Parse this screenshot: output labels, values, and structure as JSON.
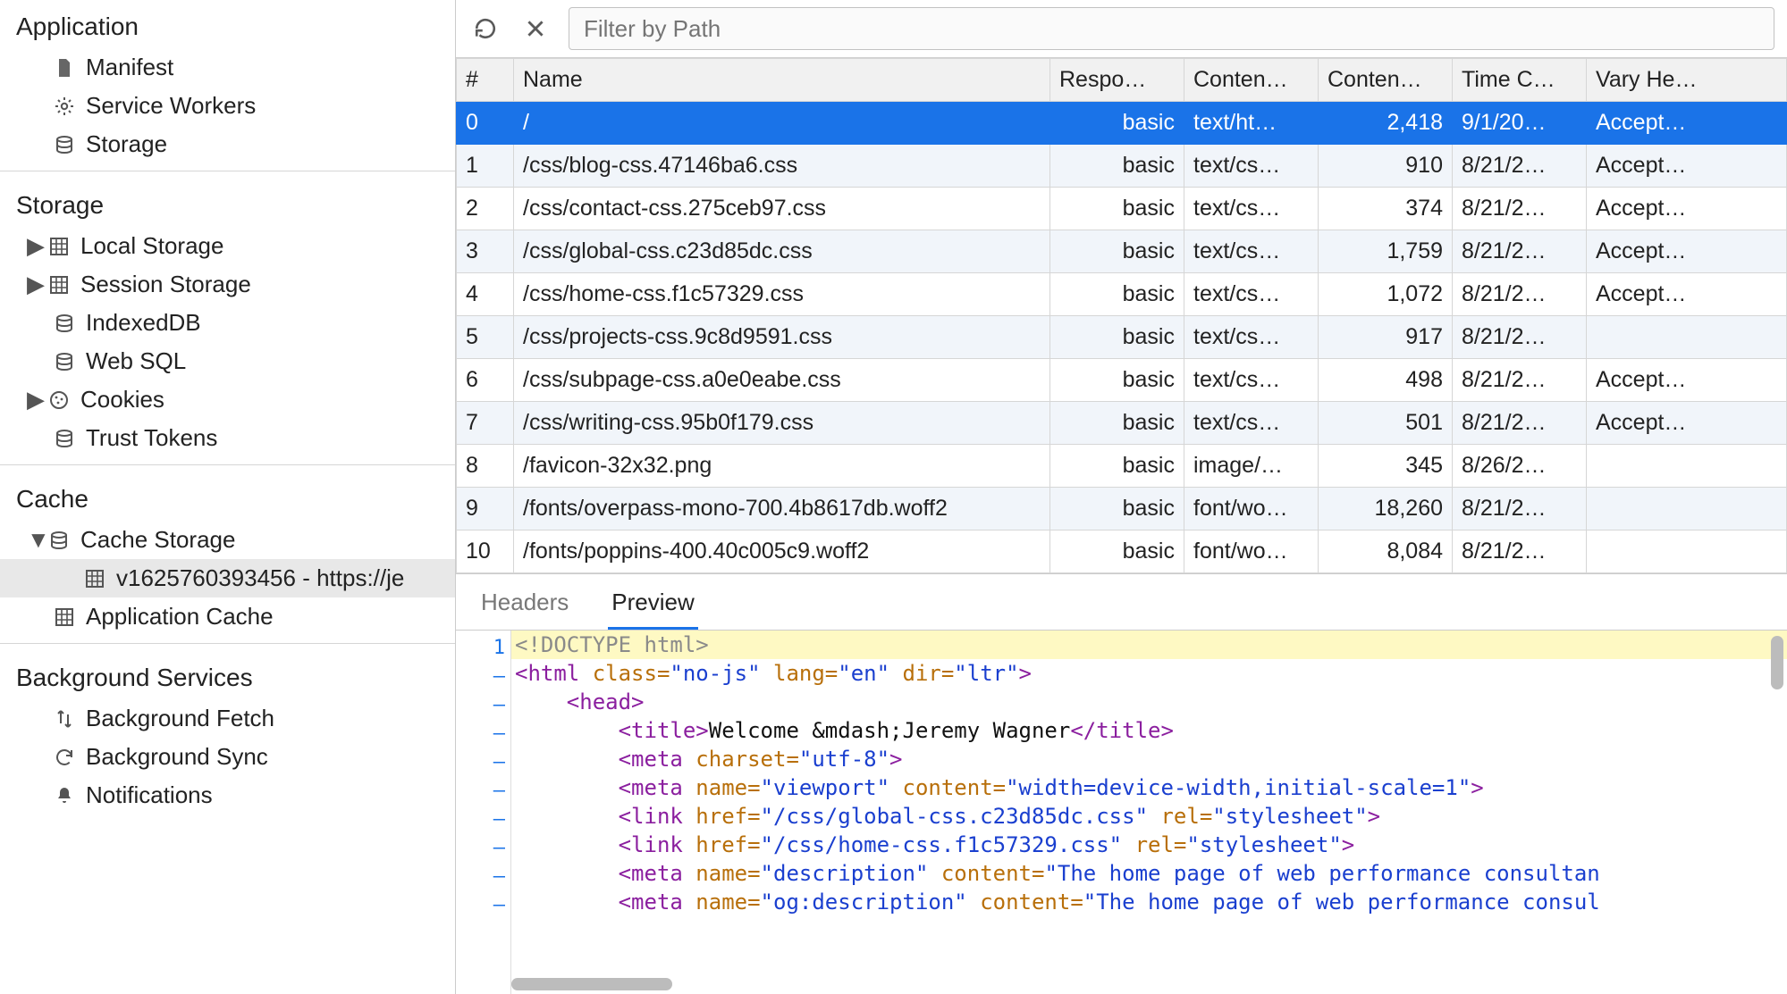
{
  "sidebar": {
    "sections": [
      {
        "title": "Application",
        "items": [
          {
            "label": "Manifest",
            "icon": "file-icon"
          },
          {
            "label": "Service Workers",
            "icon": "gear-icon"
          },
          {
            "label": "Storage",
            "icon": "disks-icon"
          }
        ]
      },
      {
        "title": "Storage",
        "items": [
          {
            "label": "Local Storage",
            "icon": "grid-icon",
            "expandable": true
          },
          {
            "label": "Session Storage",
            "icon": "grid-icon",
            "expandable": true
          },
          {
            "label": "IndexedDB",
            "icon": "disks-icon"
          },
          {
            "label": "Web SQL",
            "icon": "disks-icon"
          },
          {
            "label": "Cookies",
            "icon": "cookie-icon",
            "expandable": true
          },
          {
            "label": "Trust Tokens",
            "icon": "disks-icon"
          }
        ]
      },
      {
        "title": "Cache",
        "items": [
          {
            "label": "Cache Storage",
            "icon": "disks-icon",
            "expandable": true,
            "expanded": true,
            "children": [
              {
                "label": "v1625760393456 - https://je",
                "icon": "grid-icon",
                "selected": true
              }
            ]
          },
          {
            "label": "Application Cache",
            "icon": "grid-icon"
          }
        ]
      },
      {
        "title": "Background Services",
        "items": [
          {
            "label": "Background Fetch",
            "icon": "arrows-updown-icon"
          },
          {
            "label": "Background Sync",
            "icon": "sync-icon"
          },
          {
            "label": "Notifications",
            "icon": "bell-icon"
          }
        ]
      }
    ]
  },
  "toolbar": {
    "refresh_tooltip": "Refresh",
    "clear_tooltip": "Clear",
    "filter_placeholder": "Filter by Path"
  },
  "table": {
    "columns": [
      "#",
      "Name",
      "Respo…",
      "Conten…",
      "Conten…",
      "Time C…",
      "Vary He…"
    ],
    "rows": [
      {
        "idx": "0",
        "name": "/",
        "resp": "basic",
        "ctype": "text/ht…",
        "clen": "2,418",
        "time": "9/1/20…",
        "vary": "Accept…",
        "selected": true
      },
      {
        "idx": "1",
        "name": "/css/blog-css.47146ba6.css",
        "resp": "basic",
        "ctype": "text/cs…",
        "clen": "910",
        "time": "8/21/2…",
        "vary": "Accept…"
      },
      {
        "idx": "2",
        "name": "/css/contact-css.275ceb97.css",
        "resp": "basic",
        "ctype": "text/cs…",
        "clen": "374",
        "time": "8/21/2…",
        "vary": "Accept…"
      },
      {
        "idx": "3",
        "name": "/css/global-css.c23d85dc.css",
        "resp": "basic",
        "ctype": "text/cs…",
        "clen": "1,759",
        "time": "8/21/2…",
        "vary": "Accept…"
      },
      {
        "idx": "4",
        "name": "/css/home-css.f1c57329.css",
        "resp": "basic",
        "ctype": "text/cs…",
        "clen": "1,072",
        "time": "8/21/2…",
        "vary": "Accept…"
      },
      {
        "idx": "5",
        "name": "/css/projects-css.9c8d9591.css",
        "resp": "basic",
        "ctype": "text/cs…",
        "clen": "917",
        "time": "8/21/2…",
        "vary": ""
      },
      {
        "idx": "6",
        "name": "/css/subpage-css.a0e0eabe.css",
        "resp": "basic",
        "ctype": "text/cs…",
        "clen": "498",
        "time": "8/21/2…",
        "vary": "Accept…"
      },
      {
        "idx": "7",
        "name": "/css/writing-css.95b0f179.css",
        "resp": "basic",
        "ctype": "text/cs…",
        "clen": "501",
        "time": "8/21/2…",
        "vary": "Accept…"
      },
      {
        "idx": "8",
        "name": "/favicon-32x32.png",
        "resp": "basic",
        "ctype": "image/…",
        "clen": "345",
        "time": "8/26/2…",
        "vary": ""
      },
      {
        "idx": "9",
        "name": "/fonts/overpass-mono-700.4b8617db.woff2",
        "resp": "basic",
        "ctype": "font/wo…",
        "clen": "18,260",
        "time": "8/21/2…",
        "vary": ""
      },
      {
        "idx": "10",
        "name": "/fonts/poppins-400.40c005c9.woff2",
        "resp": "basic",
        "ctype": "font/wo…",
        "clen": "8,084",
        "time": "8/21/2…",
        "vary": ""
      }
    ]
  },
  "detail": {
    "tabs": {
      "headers": "Headers",
      "preview": "Preview"
    },
    "active_tab": "preview",
    "code_gutter": [
      "1",
      "–",
      "–",
      "–",
      "–",
      "–",
      "–",
      "–",
      "–",
      "–"
    ],
    "code": [
      {
        "highlight": true,
        "tokens": [
          {
            "cls": "tok-doctype",
            "t": "<!DOCTYPE html>"
          }
        ]
      },
      {
        "tokens": [
          {
            "cls": "tok-tag",
            "t": "<html "
          },
          {
            "cls": "tok-attr",
            "t": "class="
          },
          {
            "cls": "tok-str",
            "t": "\"no-js\" "
          },
          {
            "cls": "tok-attr",
            "t": "lang="
          },
          {
            "cls": "tok-str",
            "t": "\"en\" "
          },
          {
            "cls": "tok-attr",
            "t": "dir="
          },
          {
            "cls": "tok-str",
            "t": "\"ltr\""
          },
          {
            "cls": "tok-tag",
            "t": ">"
          }
        ]
      },
      {
        "indent": 1,
        "tokens": [
          {
            "cls": "tok-tag",
            "t": "<head>"
          }
        ]
      },
      {
        "indent": 2,
        "tokens": [
          {
            "cls": "tok-tag",
            "t": "<title>"
          },
          {
            "cls": "tok-text",
            "t": "Welcome &mdash;Jeremy Wagner"
          },
          {
            "cls": "tok-tag",
            "t": "</title>"
          }
        ]
      },
      {
        "indent": 2,
        "tokens": [
          {
            "cls": "tok-tag",
            "t": "<meta "
          },
          {
            "cls": "tok-attr",
            "t": "charset="
          },
          {
            "cls": "tok-str",
            "t": "\"utf-8\""
          },
          {
            "cls": "tok-tag",
            "t": ">"
          }
        ]
      },
      {
        "indent": 2,
        "tokens": [
          {
            "cls": "tok-tag",
            "t": "<meta "
          },
          {
            "cls": "tok-attr",
            "t": "name="
          },
          {
            "cls": "tok-str",
            "t": "\"viewport\" "
          },
          {
            "cls": "tok-attr",
            "t": "content="
          },
          {
            "cls": "tok-str",
            "t": "\"width=device-width,initial-scale=1\""
          },
          {
            "cls": "tok-tag",
            "t": ">"
          }
        ]
      },
      {
        "indent": 2,
        "tokens": [
          {
            "cls": "tok-tag",
            "t": "<link "
          },
          {
            "cls": "tok-attr",
            "t": "href="
          },
          {
            "cls": "tok-str",
            "t": "\"/css/global-css.c23d85dc.css\" "
          },
          {
            "cls": "tok-attr",
            "t": "rel="
          },
          {
            "cls": "tok-str",
            "t": "\"stylesheet\""
          },
          {
            "cls": "tok-tag",
            "t": ">"
          }
        ]
      },
      {
        "indent": 2,
        "tokens": [
          {
            "cls": "tok-tag",
            "t": "<link "
          },
          {
            "cls": "tok-attr",
            "t": "href="
          },
          {
            "cls": "tok-str",
            "t": "\"/css/home-css.f1c57329.css\" "
          },
          {
            "cls": "tok-attr",
            "t": "rel="
          },
          {
            "cls": "tok-str",
            "t": "\"stylesheet\""
          },
          {
            "cls": "tok-tag",
            "t": ">"
          }
        ]
      },
      {
        "indent": 2,
        "tokens": [
          {
            "cls": "tok-tag",
            "t": "<meta "
          },
          {
            "cls": "tok-attr",
            "t": "name="
          },
          {
            "cls": "tok-str",
            "t": "\"description\" "
          },
          {
            "cls": "tok-attr",
            "t": "content="
          },
          {
            "cls": "tok-str",
            "t": "\"The home page of web performance consultan"
          }
        ]
      },
      {
        "indent": 2,
        "tokens": [
          {
            "cls": "tok-tag",
            "t": "<meta "
          },
          {
            "cls": "tok-attr",
            "t": "name="
          },
          {
            "cls": "tok-str",
            "t": "\"og:description\" "
          },
          {
            "cls": "tok-attr",
            "t": "content="
          },
          {
            "cls": "tok-str",
            "t": "\"The home page of web performance consul"
          }
        ]
      }
    ]
  }
}
